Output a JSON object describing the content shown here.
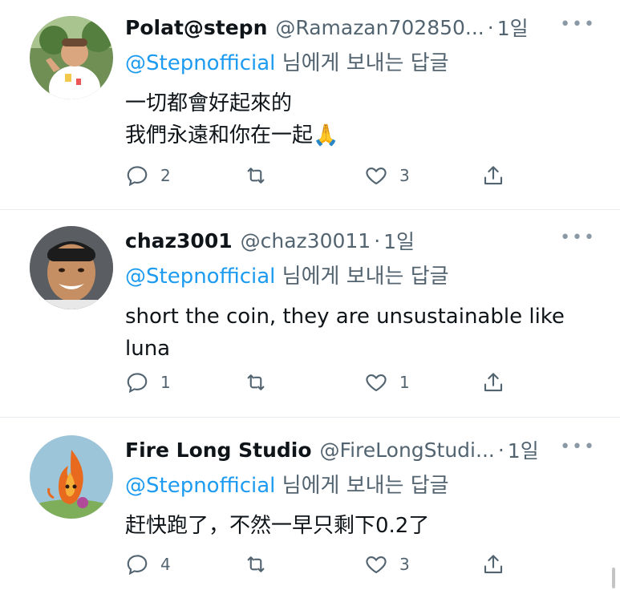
{
  "tweets": [
    {
      "name": "Polat@stepn",
      "handle": "@Ramazan702850...",
      "time": "1일",
      "reply_mention": "@Stepnofficial",
      "reply_suffix": " 님에게 보내는 답글",
      "lines": [
        "一切都會好起來的",
        "我們永遠和你在一起🙏"
      ],
      "replies": "2",
      "retweets": "",
      "likes": "3"
    },
    {
      "name": "chaz3001",
      "handle": "@chaz30011",
      "time": "1일",
      "reply_mention": "@Stepnofficial",
      "reply_suffix": " 님에게 보내는 답글",
      "lines": [
        "short the coin, they are unsustainable like",
        "luna"
      ],
      "replies": "1",
      "retweets": "",
      "likes": "1"
    },
    {
      "name": "Fire Long Studio",
      "handle": "@FireLongStudi...",
      "time": "1일",
      "reply_mention": "@Stepnofficial",
      "reply_suffix": " 님에게 보내는 답글",
      "lines": [
        "赶快跑了，不然一早只剩下0.2了"
      ],
      "replies": "4",
      "retweets": "",
      "likes": "3"
    }
  ],
  "colors": {
    "accent": "#1d9bf0",
    "text": "#0f1419",
    "muted": "#536471"
  }
}
